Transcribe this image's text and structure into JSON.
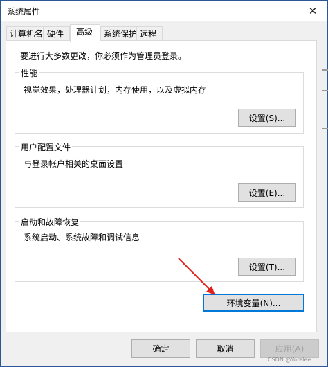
{
  "window": {
    "title": "系统属性",
    "close_glyph": "✕"
  },
  "tabs": [
    {
      "label": "计算机名"
    },
    {
      "label": "硬件"
    },
    {
      "label": "高级"
    },
    {
      "label": "系统保护"
    },
    {
      "label": "远程"
    }
  ],
  "active_tab": "高级",
  "notice": "要进行大多数更改，你必须作为管理员登录。",
  "groups": {
    "performance": {
      "title": "性能",
      "description": "视觉效果，处理器计划，内存使用，以及虚拟内存",
      "button": "设置(S)..."
    },
    "user_profiles": {
      "title": "用户配置文件",
      "description": "与登录帐户相关的桌面设置",
      "button": "设置(E)..."
    },
    "startup_recovery": {
      "title": "启动和故障恢复",
      "description": "系统启动、系统故障和调试信息",
      "button": "设置(T)..."
    }
  },
  "env_button": "环境变量(N)...",
  "footer": {
    "ok": "确定",
    "cancel": "取消",
    "apply": "应用(A)"
  },
  "watermark": "CSDN @Yorelee.",
  "colors": {
    "arrow": "#e0201a",
    "focus": "#0078d7",
    "title_border": "#2b5797"
  }
}
